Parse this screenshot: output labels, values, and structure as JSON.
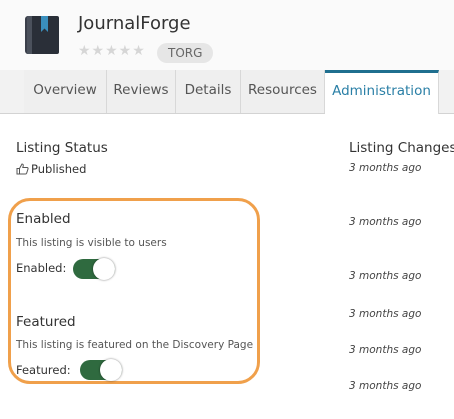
{
  "app": {
    "title": "JournalForge",
    "tag": "TORG",
    "stars_glyph": "★★★★★",
    "rating_filled": 0
  },
  "tabs": [
    {
      "label": "Overview"
    },
    {
      "label": "Reviews"
    },
    {
      "label": "Details"
    },
    {
      "label": "Resources"
    },
    {
      "label": "Administration",
      "active": true
    }
  ],
  "status": {
    "heading": "Listing Status",
    "value": "Published",
    "icon": "thumbs-up-icon"
  },
  "enabled": {
    "heading": "Enabled",
    "description": "This listing is visible to users",
    "label": "Enabled:",
    "on": true
  },
  "featured": {
    "heading": "Featured",
    "description": "This listing is featured on the Discovery Page",
    "label": "Featured:",
    "on": true
  },
  "changes": {
    "heading": "Listing Changes",
    "items": [
      "3 months ago",
      "3 months ago",
      "3 months ago",
      "3 months ago",
      "3 months ago",
      "3 months ago"
    ]
  },
  "colors": {
    "accent": "#1f6f8f",
    "toggle_on": "#2f6a3f",
    "highlight": "#f0a04b"
  }
}
